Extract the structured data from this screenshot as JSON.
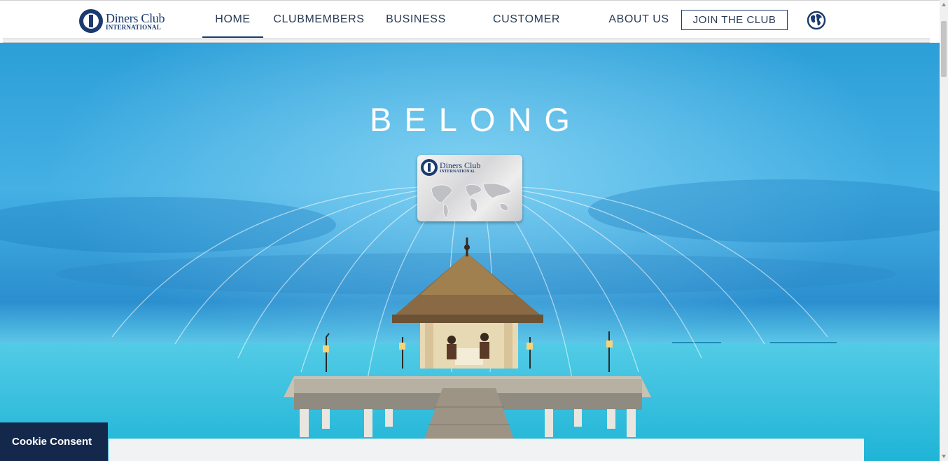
{
  "brand": {
    "name_line1": "Diners Club",
    "name_line2": "INTERNATIONAL"
  },
  "nav": {
    "items": [
      {
        "label": "HOME"
      },
      {
        "label": "CLUBMEMBERS"
      },
      {
        "label": "BUSINESS"
      },
      {
        "label": "CUSTOMER SERVICE"
      },
      {
        "label": "ABOUT US"
      }
    ],
    "active_index": 0,
    "join_label": "JOIN THE CLUB",
    "globe_icon": "globe-icon"
  },
  "hero": {
    "title": "BELONG",
    "card": {
      "brand_line1": "Diners Club",
      "brand_line2": "INTERNATIONAL"
    }
  },
  "cookie": {
    "label": "Cookie Consent"
  },
  "colors": {
    "brand_navy": "#1b3a6e",
    "nav_text": "#2a3b55",
    "cookie_bg": "#14284b",
    "sky": "#3aaee0",
    "sea": "#2fc4e0"
  }
}
